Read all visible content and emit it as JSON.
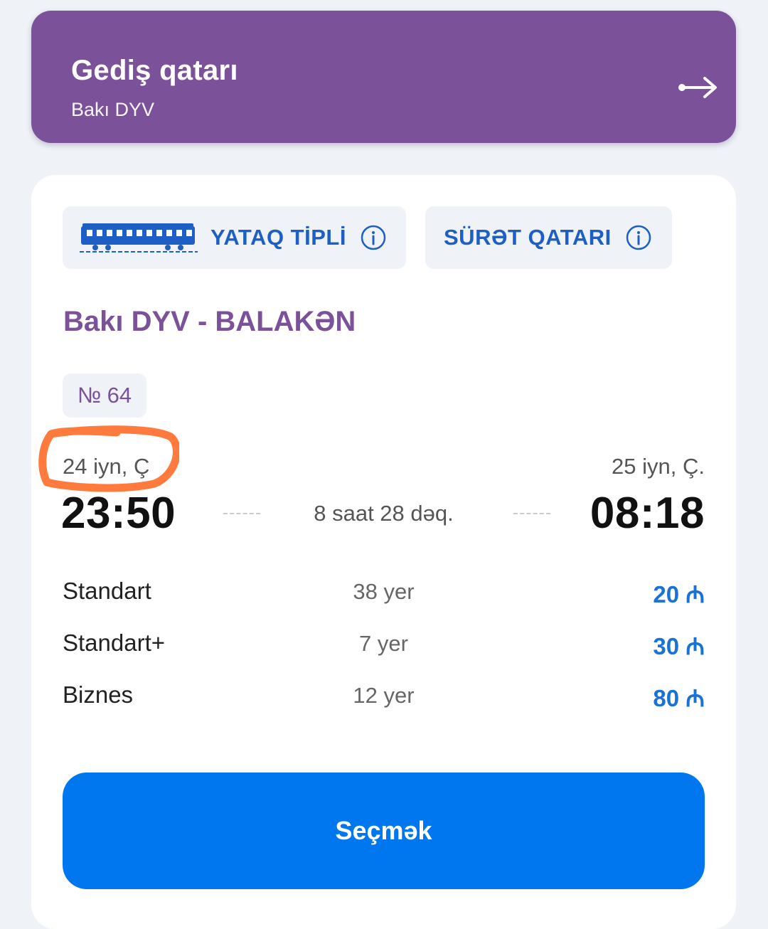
{
  "header": {
    "title": "Gediş qatarı",
    "subtitle": "Bakı DYV"
  },
  "tags": [
    {
      "label": "YATAQ TİPLİ",
      "icon": "train-icon"
    },
    {
      "label": "SÜRƏT QATARI",
      "icon": "info-icon"
    }
  ],
  "route": "Bakı DYV - BALAKƏN",
  "train_number": "№ 64",
  "departure": {
    "date": "24 iyn, Ç",
    "time": "23:50"
  },
  "arrival": {
    "date": "25 iyn, Ç.",
    "time": "08:18"
  },
  "duration": "8 saat 28 dəq.",
  "fares": [
    {
      "class": "Standart",
      "seats": "38 yer",
      "price": "20 ₼"
    },
    {
      "class": "Standart+",
      "seats": "7 yer",
      "price": "30 ₼"
    },
    {
      "class": "Biznes",
      "seats": "12 yer",
      "price": "80 ₼"
    }
  ],
  "select_button": "Seçmək",
  "colors": {
    "accent_purple": "#7b5299",
    "accent_blue": "#0077ee",
    "price_blue": "#1b72d6",
    "annotation_orange": "#ff7a3d"
  }
}
